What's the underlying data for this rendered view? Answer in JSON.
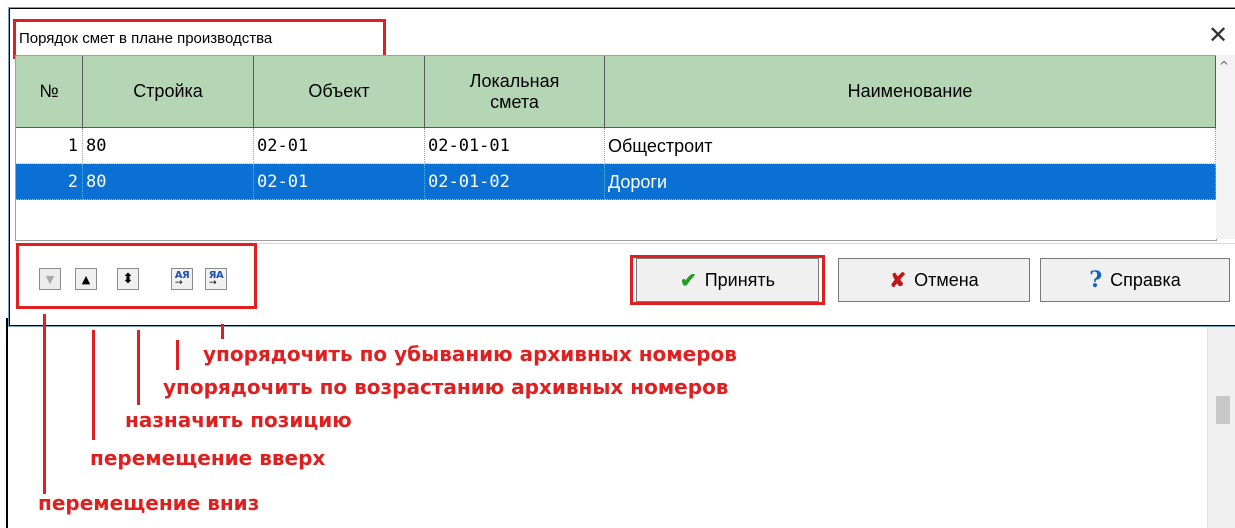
{
  "dialog": {
    "title": "Порядок смет в плане производства",
    "close_glyph": "✕"
  },
  "table": {
    "columns": [
      "№",
      "Стройка",
      "Объект",
      "Локальная смета",
      "Наименование"
    ],
    "rows": [
      {
        "num": "1",
        "stroyka": "80",
        "object": "02-01",
        "smeta": "02-01-01",
        "name": "Общестроит",
        "selected": false
      },
      {
        "num": "2",
        "stroyka": "80",
        "object": "02-01",
        "smeta": "02-01-02",
        "name": "Дороги",
        "selected": true
      }
    ],
    "selection_color": "#0a70d4",
    "header_color": "#b5d6b5"
  },
  "toolbar": {
    "move_down_icon": "▼",
    "move_up_icon": "▲",
    "set_position_icon": "⬍",
    "sort_asc_text": "АЯ",
    "sort_desc_text": "ЯА",
    "sort_arrow": "→"
  },
  "buttons": {
    "accept": "Принять",
    "cancel": "Отмена",
    "help": "Справка",
    "accept_icon": "✔",
    "cancel_icon": "✘",
    "help_icon": "?"
  },
  "annotations": {
    "sort_desc": "упорядочить по убыванию архивных номеров",
    "sort_asc": "упорядочить по возрастанию архивных номеров",
    "set_position": "назначить позицию",
    "move_up": "перемещение вверх",
    "move_down": "перемещение вниз",
    "color": "#e02020"
  }
}
